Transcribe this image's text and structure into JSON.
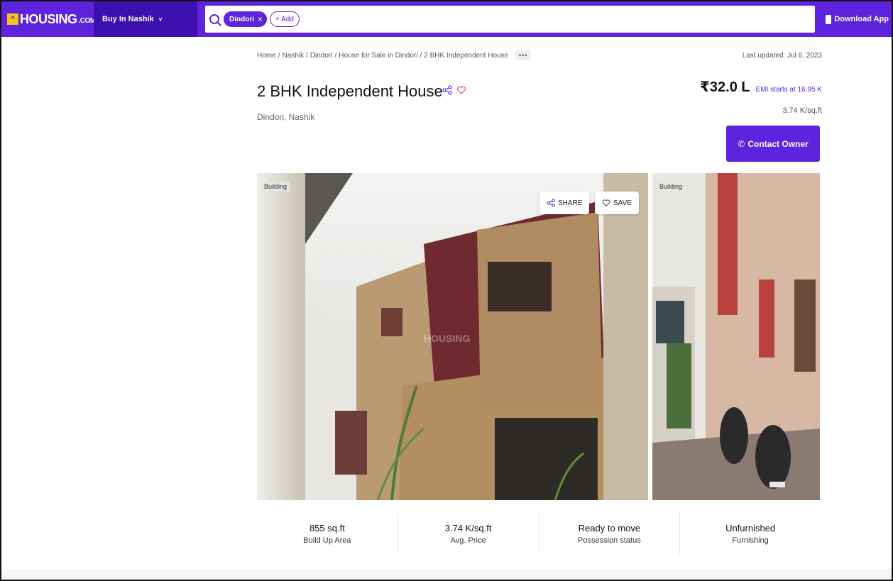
{
  "header": {
    "logo_text": "HOUSING",
    "logo_suffix": ".COM",
    "city_select": "Buy In Nashik",
    "search_chip": "Dindori",
    "add_chip": "+ Add",
    "download_app": "Download App"
  },
  "breadcrumb": [
    "Home",
    "Nashik",
    "Dindori",
    "House for Sale in Dindori",
    "2 BHK Independent House"
  ],
  "breadcrumb_more": "•••",
  "last_updated": "Last updated: Jul 6, 2023",
  "listing": {
    "title": "2 BHK Independent House",
    "location": "Dindori, Nashik",
    "price": "₹32.0 L",
    "emi": "EMI starts at 16.95 K",
    "price_per_sqft": "3.74 K/sq.ft",
    "contact_button": "Contact Owner"
  },
  "gallery": {
    "main_badge": "Building",
    "side_badge": "Building",
    "share_label": "SHARE",
    "save_label": "SAVE",
    "watermark": "HOUSING"
  },
  "stats": [
    {
      "value": "855 sq.ft",
      "label": "Build Up Area"
    },
    {
      "value": "3.74 K/sq.ft",
      "label": "Avg. Price"
    },
    {
      "value": "Ready to move",
      "label": "Possession status"
    },
    {
      "value": "Unfurnished",
      "label": "Furnishing"
    }
  ],
  "colors": {
    "brand": "#5e23dc",
    "brand_dark": "#3d0fb0",
    "logo_yellow": "#f5c518"
  }
}
